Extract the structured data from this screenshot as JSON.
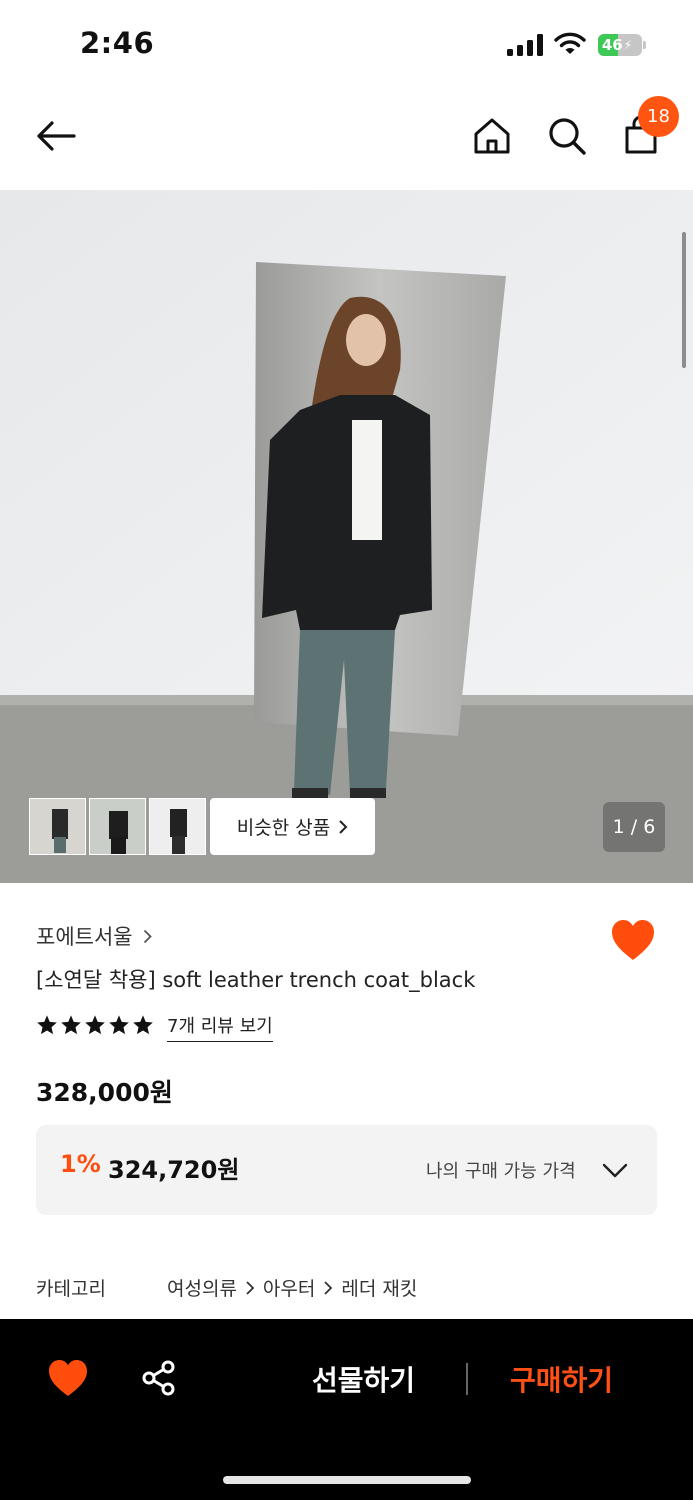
{
  "status_bar": {
    "time": "2:46",
    "battery": "46",
    "battery_level": 0.46
  },
  "header": {
    "cart_count": "18"
  },
  "gallery": {
    "similar_label": "비슷한 상품",
    "counter": "1 / 6",
    "thumbnails": [
      "thumbnail-1",
      "thumbnail-2",
      "thumbnail-3"
    ]
  },
  "product": {
    "brand": "포에트서울",
    "title": "[소연달 착용] soft leather trench coat_black",
    "rating_stars": 5,
    "review_link": "7개 리뷰 보기",
    "price": "328,000원",
    "discount_rate": "1%",
    "discount_price": "324,720원",
    "discount_label": "나의 구매 가능 가격",
    "category_label": "카테고리",
    "category_path": [
      "여성의류",
      "아우터",
      "레더 재킷"
    ]
  },
  "bottom_bar": {
    "gift_label": "선물하기",
    "buy_label": "구매하기"
  },
  "colors": {
    "accent": "#ff5511",
    "heart": "#ff4d0d",
    "bottom_bar": "#000000"
  },
  "icons": [
    "back-arrow-icon",
    "home-icon",
    "search-icon",
    "shopping-bag-icon",
    "heart-icon",
    "share-icon",
    "chevron-right-icon",
    "chevron-down-icon",
    "star-icon"
  ]
}
